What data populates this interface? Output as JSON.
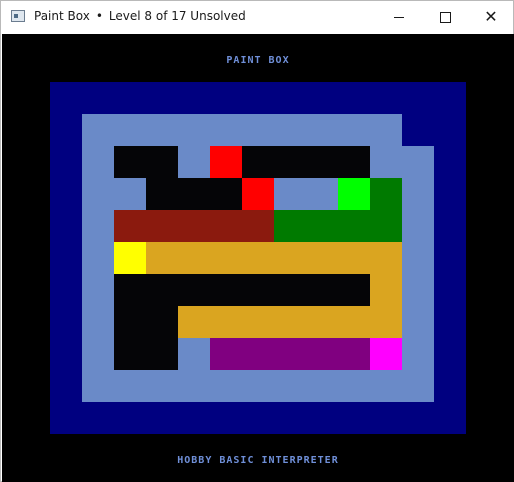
{
  "window": {
    "app_name": "Paint Box",
    "separator": "•",
    "status": "Level 8 of 17 Unsolved",
    "minimize_icon": "minimize-icon",
    "maximize_icon": "maximize-icon",
    "close_icon": "close-icon"
  },
  "game": {
    "title": "PAINT BOX",
    "footer": "HOBBY BASIC INTERPRETER",
    "colors": {
      "text": "#6f8fd8",
      "frame": "#000080",
      "wall": "#6a8ac8",
      "empty": "#050507"
    },
    "level": 8,
    "total_levels": 17,
    "solved": false,
    "grid": [
      "NNNNNNNNNNNNN",
      "NWWWWWWWWWWNN",
      "NWEEWREEEEWWN",
      "NWWEEERWWGTWN",
      "NWOOOOOTTTTWN",
      "NWYPPPPPPPPWN",
      "NWEEEEEEEEPWN",
      "NWEEPPPPPPPWN",
      "NWEEWUUUUUMWN",
      "NWWWWWWWWWWWN",
      "NNNNNNNNNNNNN"
    ],
    "grid_fix": {
      "note_free": true
    },
    "cell_colors": {
      "N": "#000080",
      "W": "#6a8ac8",
      "E": "#050507",
      "R": "#ff0000",
      "O": "#8b1a0e",
      "G": "#00ff00",
      "T": "#007a00",
      "Y": "#ffff00",
      "P": "#daa520",
      "U": "#800080",
      "M": "#ff00ff",
      "X": "#000000"
    }
  }
}
